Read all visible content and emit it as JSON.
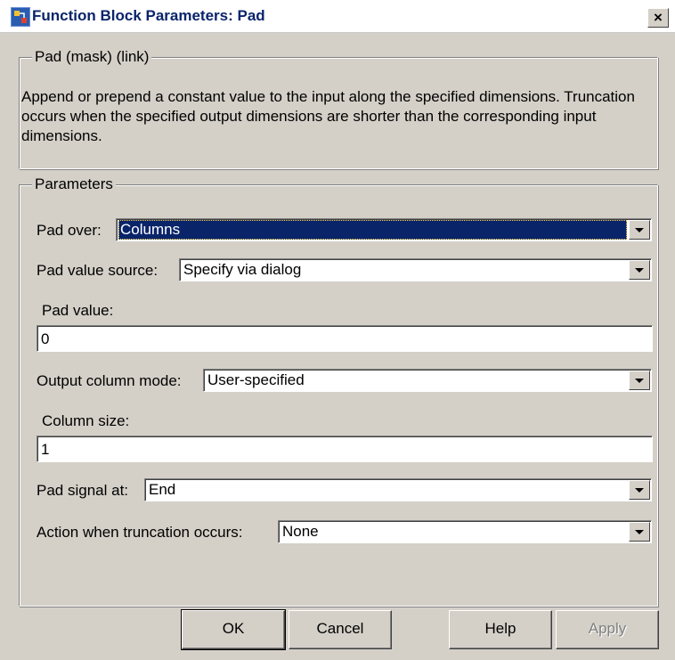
{
  "window": {
    "title": "Function Block Parameters: Pad",
    "close_label": "×"
  },
  "mask_group": {
    "legend": "Pad (mask) (link)",
    "description": "Append or prepend a constant value to the input along the specified dimensions. Truncation occurs when the specified output dimensions are shorter than the corresponding input dimensions."
  },
  "params_group": {
    "legend": "Parameters",
    "pad_over": {
      "label": "Pad over:",
      "value": "Columns"
    },
    "pad_value_source": {
      "label": "Pad value source:",
      "value": "Specify via dialog"
    },
    "pad_value": {
      "label": "Pad value:",
      "value": "0"
    },
    "output_column_mode": {
      "label": "Output column mode:",
      "value": "User-specified"
    },
    "column_size": {
      "label": "Column size:",
      "value": "1"
    },
    "pad_signal_at": {
      "label": "Pad signal at:",
      "value": "End"
    },
    "action_truncation": {
      "label": "Action when truncation occurs:",
      "value": "None"
    }
  },
  "buttons": {
    "ok": "OK",
    "cancel": "Cancel",
    "help": "Help",
    "apply": "Apply"
  },
  "colors": {
    "selection": "#0a246a",
    "title_text": "#0a246a",
    "face": "#d4d0c8"
  }
}
